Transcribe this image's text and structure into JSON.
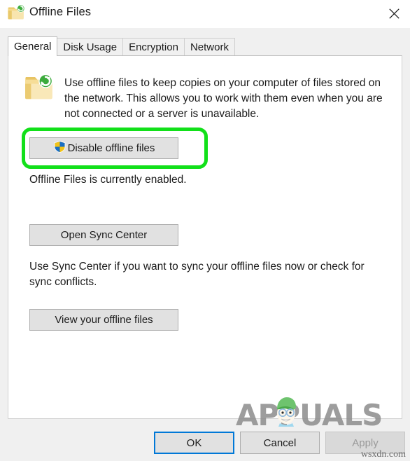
{
  "window": {
    "title": "Offline Files",
    "title_icon": "offline-folder-sync-icon",
    "close_label": "✕"
  },
  "tabs": [
    {
      "label": "General",
      "selected": true
    },
    {
      "label": "Disk Usage",
      "selected": false
    },
    {
      "label": "Encryption",
      "selected": false
    },
    {
      "label": "Network",
      "selected": false
    }
  ],
  "general": {
    "info_icon": "offline-folder-sync-icon",
    "info_text": "Use offline files to keep copies on your computer of files stored on the network.  This allows you to work with them even when you are not connected or a server is unavailable.",
    "disable_button": {
      "label": "Disable offline files",
      "icon": "uac-shield-icon",
      "highlighted": true
    },
    "status_text": "Offline Files is currently enabled.",
    "sync_button": {
      "label": "Open Sync Center"
    },
    "sync_help_text": "Use Sync Center if you want to sync your offline files now or check for sync conflicts.",
    "view_button": {
      "label": "View your offline files"
    }
  },
  "command_bar": {
    "ok_label": "OK",
    "cancel_label": "Cancel",
    "apply_label": "Apply",
    "apply_disabled": true
  },
  "watermarks": {
    "brand": "APPUALS",
    "site": "wsxdn.com"
  },
  "colors": {
    "highlight_green": "#12e01a",
    "focus_blue": "#0078d7",
    "window_bg": "#f0f0f0",
    "panel_bg": "#ffffff",
    "button_face": "#e1e1e1",
    "disabled_text": "#9a9a9a"
  }
}
